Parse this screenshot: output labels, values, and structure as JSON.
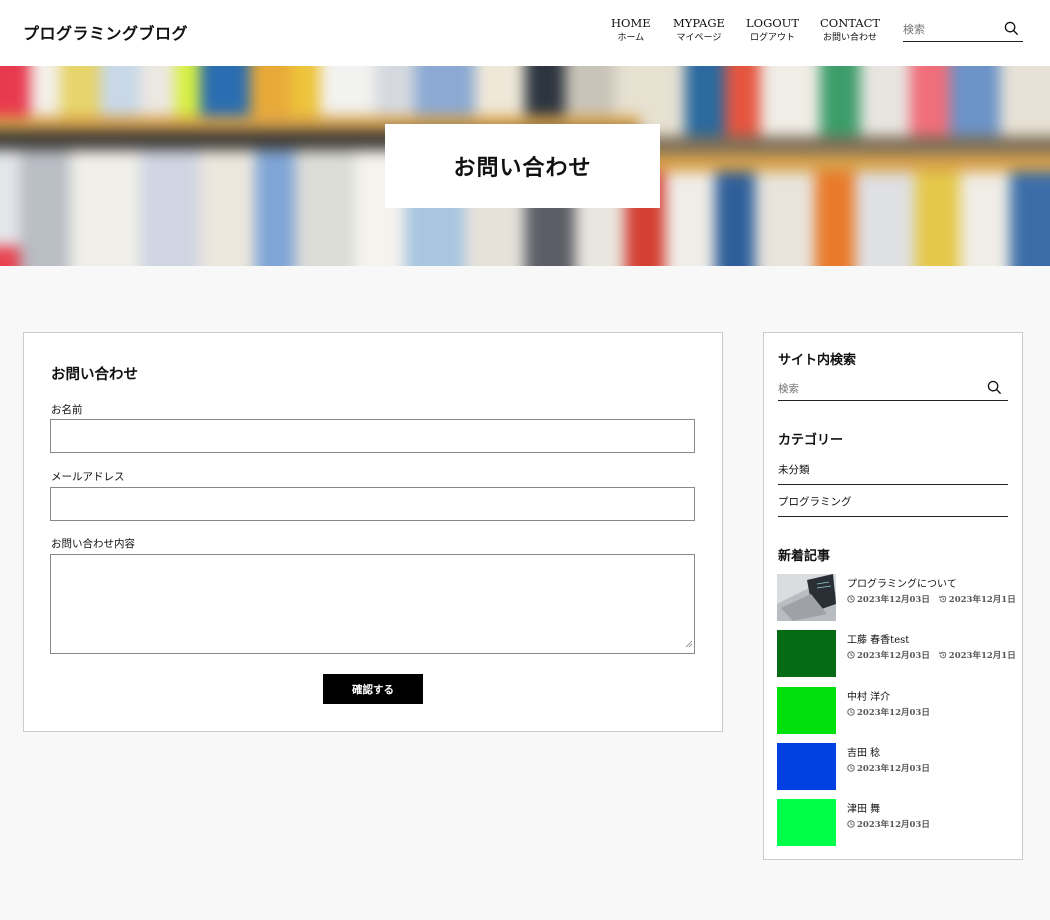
{
  "header": {
    "logo": "プログラミングブログ",
    "nav": [
      {
        "en": "HOME",
        "ja": "ホーム"
      },
      {
        "en": "MYPAGE",
        "ja": "マイページ"
      },
      {
        "en": "LOGOUT",
        "ja": "ログアウト"
      },
      {
        "en": "CONTACT",
        "ja": "お問い合わせ"
      }
    ],
    "search_placeholder": "検索"
  },
  "hero": {
    "title": "お問い合わせ"
  },
  "form": {
    "heading": "お問い合わせ",
    "name_label": "お名前",
    "email_label": "メールアドレス",
    "message_label": "お問い合わせ内容",
    "submit_label": "確認する"
  },
  "sidebar": {
    "search_heading": "サイト内検索",
    "search_placeholder": "検索",
    "category_heading": "カテゴリー",
    "categories": [
      "未分類",
      "プログラミング"
    ],
    "recent_heading": "新着記事",
    "posts": [
      {
        "title": "プログラミングについて",
        "date": "2023年12月03日",
        "updated": "2023年12月1日",
        "thumb": "laptop"
      },
      {
        "title": "工藤 春香test",
        "date": "2023年12月03日",
        "updated": "2023年12月1日",
        "thumb": "#056b14"
      },
      {
        "title": "中村 洋介",
        "date": "2023年12月03日",
        "updated": "",
        "thumb": "#00e10c"
      },
      {
        "title": "吉田 稔",
        "date": "2023年12月03日",
        "updated": "",
        "thumb": "#0040e0"
      },
      {
        "title": "津田 舞",
        "date": "2023年12月03日",
        "updated": "",
        "thumb": "#00ff48"
      }
    ]
  },
  "colors": {
    "background": "#f7f8f7",
    "button": "#000000",
    "border": "#cccccc"
  }
}
